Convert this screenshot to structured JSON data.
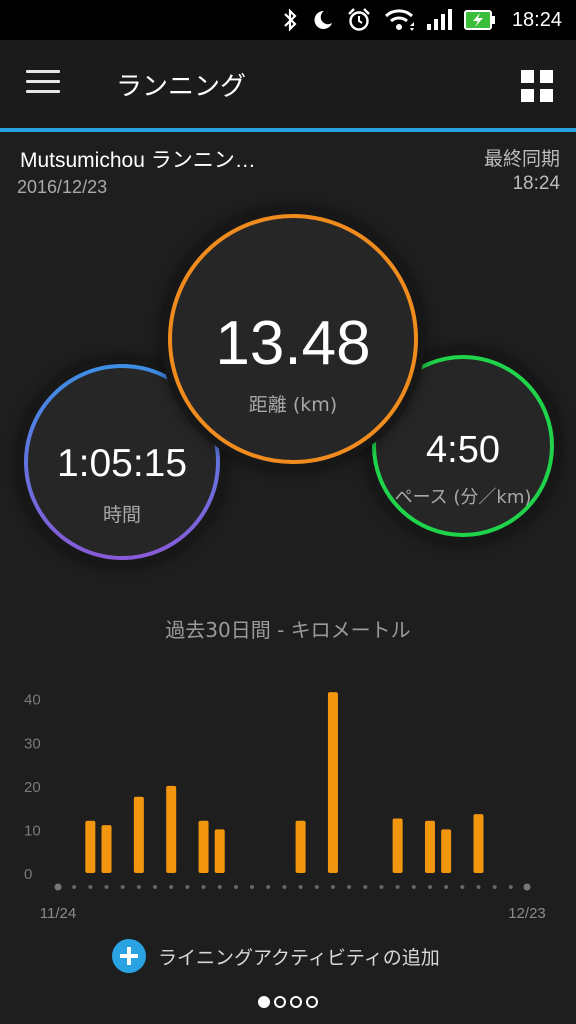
{
  "status_bar": {
    "time": "18:24",
    "icons": [
      "bluetooth-icon",
      "moon-icon",
      "alarm-icon",
      "wifi-icon",
      "signal-icon",
      "battery-charging-icon"
    ]
  },
  "app_bar": {
    "title": "ランニング",
    "menu_icon": "hamburger-menu-icon",
    "grid_icon": "grid-view-icon"
  },
  "activity": {
    "name": "Mutsumichou ランニン…",
    "date": "2016/12/23",
    "sync_label": "最終同期",
    "sync_time": "18:24"
  },
  "stats": {
    "distance": {
      "value": "13.48",
      "label": "距離 (km)"
    },
    "time": {
      "value": "1:05:15",
      "label": "時間"
    },
    "pace": {
      "value": "4:50",
      "label": "ペース (分／km)"
    }
  },
  "colors": {
    "accent": "#2aa3e3",
    "distance_ring": "#f08c1e",
    "time_ring_start": "#3c8fe6",
    "time_ring_end": "#8a5ad8",
    "pace_ring": "#1fd44a",
    "bar": "#f2950f"
  },
  "chart_data": {
    "type": "bar",
    "title": "過去30日間 - キロメートル",
    "x_start_label": "11/24",
    "x_end_label": "12/23",
    "yticks": [
      0,
      10,
      20,
      30,
      40
    ],
    "ylim": [
      0,
      42
    ],
    "grid": false,
    "values": [
      0,
      0,
      12,
      11,
      0,
      17.5,
      0,
      20,
      0,
      12,
      10,
      0,
      0,
      0,
      0,
      12,
      0,
      41.5,
      0,
      0,
      0,
      12.5,
      0,
      12,
      10,
      0,
      13.5,
      0,
      0,
      0
    ]
  },
  "add_activity": {
    "label": "ライニングアクティビティの追加",
    "icon": "plus-icon"
  },
  "pagination": {
    "count": 4,
    "active": 1
  }
}
